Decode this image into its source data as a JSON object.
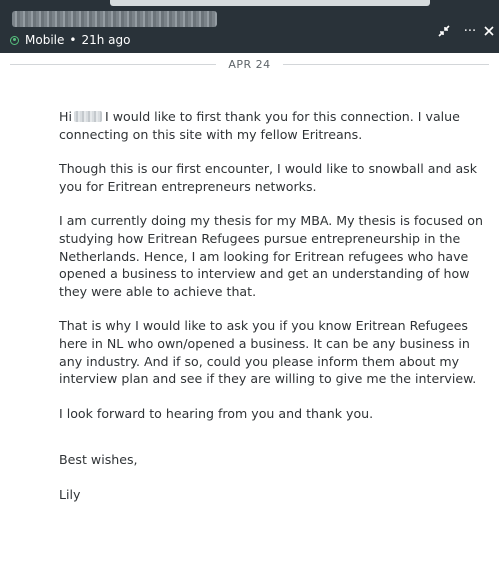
{
  "header": {
    "status": "Mobile",
    "separator": "•",
    "last_seen": "21h ago",
    "more_label": "···"
  },
  "divider": {
    "date": "APR 24"
  },
  "message": {
    "greeting_prefix": "Hi",
    "greeting_rest": "I would like to first thank you for this connection. I value connecting on this site with my fellow Eritreans.",
    "p2": "Though this is our first encounter, I would like to snowball and ask you for Eritrean entrepreneurs networks.",
    "p3": "I am currently doing my thesis for my MBA. My thesis is focused on studying how Eritrean Refugees pursue entrepreneurship in the Netherlands. Hence, I am looking for Eritrean refugees who have opened a business to interview and get an understanding of how they were able to achieve that.",
    "p4": "That is why I would like to ask you if you know Eritrean Refugees here in NL who own/opened a business. It can be any business in any industry. And if so, could you please inform them about my interview plan and see if they are willing to give me the interview.",
    "p5": "I look forward to hearing from you and thank you.",
    "closing": "Best wishes,",
    "signature": "Lily"
  },
  "colors": {
    "header_bg": "#293239",
    "online_green": "#57c17e",
    "body_text": "#2f3336"
  },
  "icons": [
    "online-status-icon",
    "minimize-icon",
    "more-options-icon",
    "close-icon"
  ]
}
